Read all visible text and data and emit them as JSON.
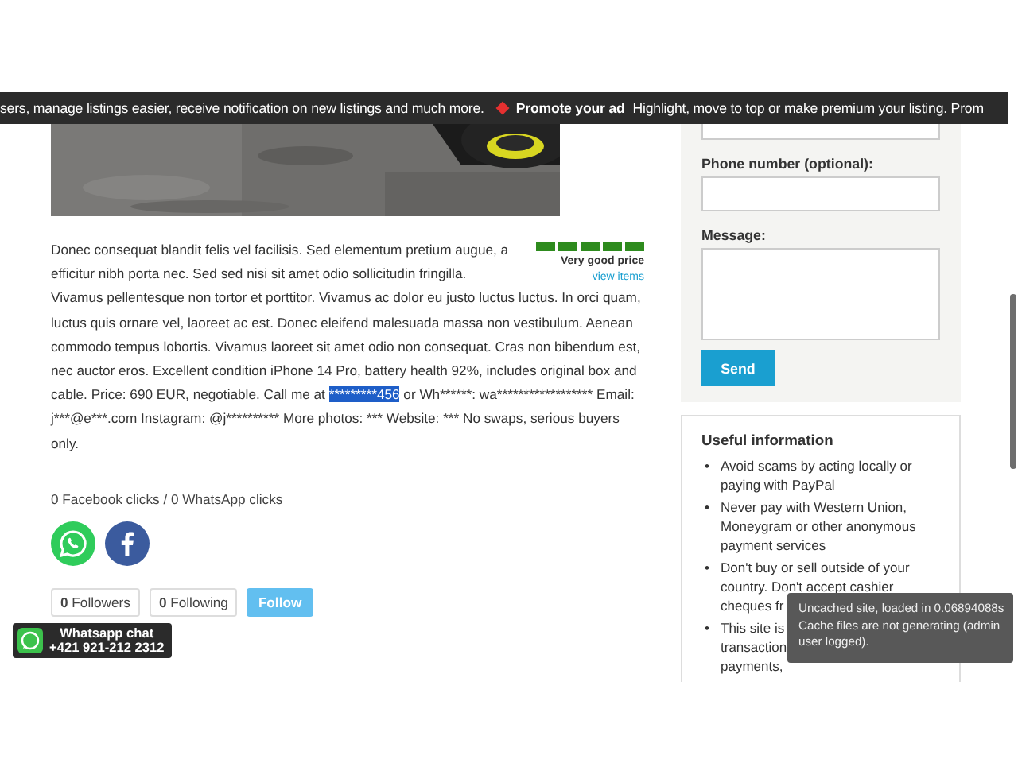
{
  "ticker": {
    "lead": "sers, manage listings easier, receive notification on new listings and much more.",
    "promo_title": "Promote your ad",
    "promo_text": "Highlight, move to top or make premium your listing. Prom"
  },
  "listing": {
    "price_rating": {
      "stars": 5,
      "label": "Very good price",
      "link": "view items"
    },
    "description": [
      {
        "text": "Donec consequat blandit felis vel facilisis. Sed elementum pretium augue, a efficitur nibh porta nec. Sed sed nisi sit amet odio sollicitudin fringilla. Vivamus pellentesque non tortor et porttitor. Vivamus ac dolor eu justo luctus luctus. In orci quam, luctus quis ornare vel, laoreet ac est. Donec eleifend malesuada massa non vestibulum. Aenean commodo tempus lobortis. Vivamus laoreet sit amet odio non consequat. Cras non bibendum est, nec auctor eros. Excellent condition iPhone 14 Pro, battery health 92%, includes original box and cable. Price: 690 EUR, negotiable. Call me at ",
        "highlighted": false
      },
      {
        "text": "*********456",
        "highlighted": true
      },
      {
        "text": " or Wh******: wa****************** Email: j***@e***.com Instagram: @j********** More photos: *** Website: *** No swaps, serious buyers only.",
        "highlighted": false
      }
    ],
    "click_stats": "0 Facebook clicks / 0 WhatsApp clicks",
    "share_buttons": [
      {
        "kind": "whatsapp"
      },
      {
        "kind": "facebook"
      }
    ],
    "social": [
      {
        "kind": "count",
        "count": "0",
        "label": "Followers"
      },
      {
        "kind": "count",
        "count": "0",
        "label": "Following"
      },
      {
        "kind": "follow",
        "label": "Follow"
      }
    ]
  },
  "contact_form": {
    "fields": [
      {
        "kind": "input"
      },
      {
        "kind": "input",
        "label": "Phone number (optional):"
      },
      {
        "kind": "textarea",
        "label": "Message:"
      }
    ],
    "send_button": "Send"
  },
  "useful_info": {
    "title": "Useful information",
    "items": [
      {
        "bullet": "•",
        "lines": [
          "Avoid scams by acting locally or",
          "paying with PayPal"
        ]
      },
      {
        "bullet": "•",
        "lines": [
          "Never pay with Western Union,",
          "Moneygram or other anonymous",
          "payment services"
        ]
      },
      {
        "bullet": "•",
        "lines": [
          "Don't buy or sell outside of your",
          "country. Don't accept cashier",
          "cheques fr"
        ]
      },
      {
        "bullet": "•",
        "lines": [
          "This site is",
          "transaction",
          "payments,"
        ]
      }
    ]
  },
  "whatsapp_chat": {
    "title": "Whatsapp chat",
    "phone": "+421 921-212 2312"
  },
  "cache_notice": "Uncached site, loaded in 0.06894088s Cache files are not generating (admin user logged)."
}
